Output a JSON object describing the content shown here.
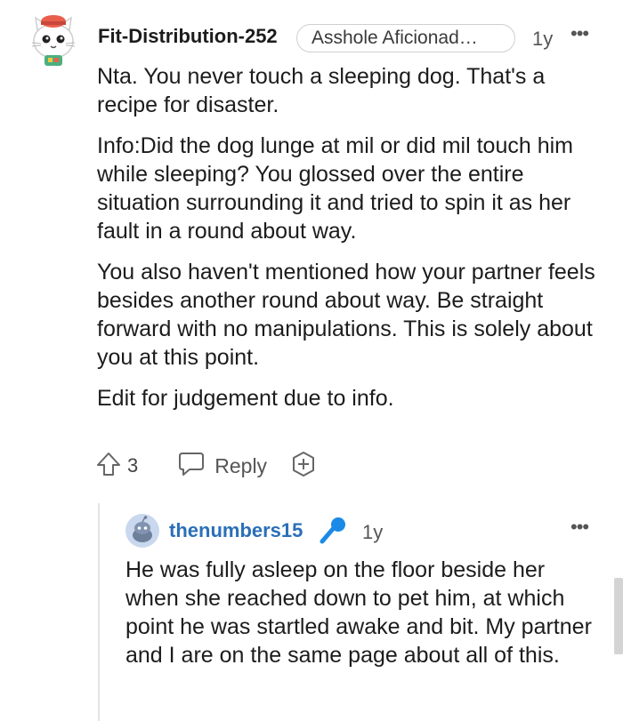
{
  "comment": {
    "username": "Fit-Distribution-252",
    "flair": "Asshole Aficionad…",
    "age": "1y",
    "more_label": "•••",
    "paragraphs": [
      "Nta. You never touch a sleeping dog. That's a recipe for disaster.",
      "Info:Did the dog lunge at mil or did mil touch him while sleeping? You glossed over the entire situation surrounding it and tried to spin it as her fault in a round about way.",
      "You also haven't mentioned how your partner feels besides another round about way. Be straight forward with no manipulations. This is solely about you at this point.",
      "Edit for judgement due to info."
    ],
    "vote_count": "3",
    "reply_label": "Reply"
  },
  "reply": {
    "username": "thenumbers15",
    "age": "1y",
    "more_label": "•••",
    "text": "He was fully asleep on the floor beside her when she reached down to pet him, at which point he was startled awake and bit. My partner and I are on the same page about all of this."
  },
  "colors": {
    "username_link": "#2a6fb8",
    "mic_icon": "#1a8ae6",
    "thread_line": "#e4e4e4"
  },
  "icons": [
    "cat-avatar",
    "upvote-icon",
    "reply-icon",
    "award-icon",
    "snoo-avatar",
    "microphone-icon"
  ]
}
